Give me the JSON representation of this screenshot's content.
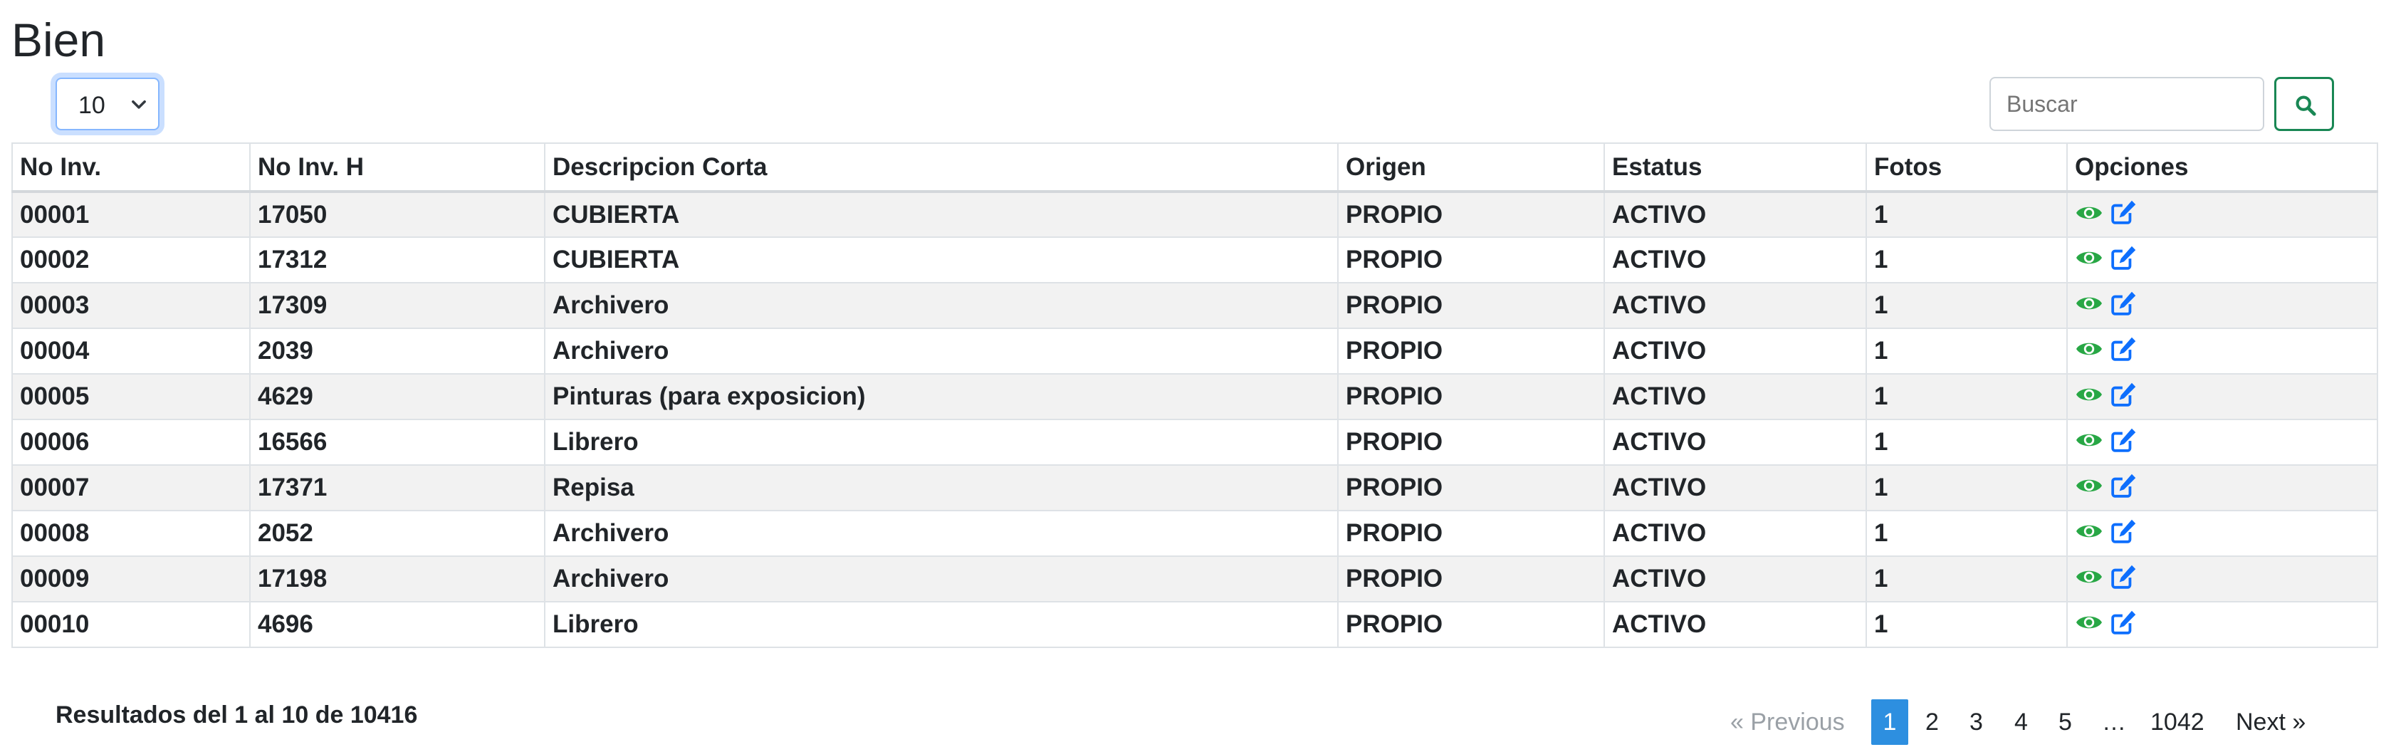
{
  "page": {
    "title": "Bien"
  },
  "controls": {
    "page_size": "10",
    "search_placeholder": "Buscar"
  },
  "table": {
    "headers": [
      "No Inv.",
      "No Inv. H",
      "Descripcion Corta",
      "Origen",
      "Estatus",
      "Fotos",
      "Opciones"
    ],
    "rows": [
      [
        "00001",
        "17050",
        "CUBIERTA",
        "PROPIO",
        "ACTIVO",
        "1"
      ],
      [
        "00002",
        "17312",
        "CUBIERTA",
        "PROPIO",
        "ACTIVO",
        "1"
      ],
      [
        "00003",
        "17309",
        "Archivero",
        "PROPIO",
        "ACTIVO",
        "1"
      ],
      [
        "00004",
        "2039",
        "Archivero",
        "PROPIO",
        "ACTIVO",
        "1"
      ],
      [
        "00005",
        "4629",
        "Pinturas (para exposicion)",
        "PROPIO",
        "ACTIVO",
        "1"
      ],
      [
        "00006",
        "16566",
        "Librero",
        "PROPIO",
        "ACTIVO",
        "1"
      ],
      [
        "00007",
        "17371",
        "Repisa",
        "PROPIO",
        "ACTIVO",
        "1"
      ],
      [
        "00008",
        "2052",
        "Archivero",
        "PROPIO",
        "ACTIVO",
        "1"
      ],
      [
        "00009",
        "17198",
        "Archivero",
        "PROPIO",
        "ACTIVO",
        "1"
      ],
      [
        "00010",
        "4696",
        "Librero",
        "PROPIO",
        "ACTIVO",
        "1"
      ]
    ],
    "row_icons": [
      "eye-icon",
      "edit-icon"
    ]
  },
  "footer": {
    "results_text": "Resultados del 1 al 10 de 10416",
    "pagination": {
      "previous": "«  Previous",
      "pages": [
        "1",
        "2",
        "3",
        "4",
        "5",
        "…",
        "1042"
      ],
      "next": "Next  »",
      "active": "1"
    }
  },
  "colors": {
    "view_icon": "#28a745",
    "edit_icon": "#0d6efd",
    "search_button": "#198754",
    "active_page": "#2d8fe0"
  }
}
